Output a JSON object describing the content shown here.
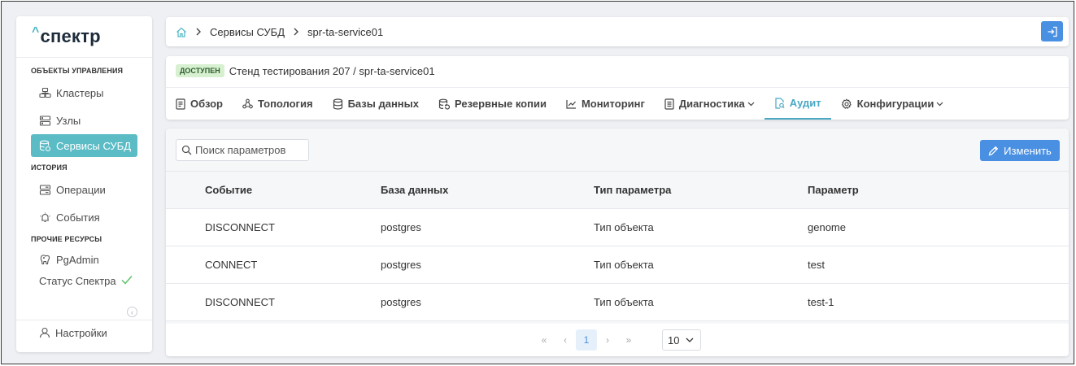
{
  "app": {
    "logo": "спектр"
  },
  "sidebar": {
    "sections": [
      {
        "title": "ОБЪЕКТЫ УПРАВЛЕНИЯ"
      },
      {
        "title": "ИСТОРИЯ"
      },
      {
        "title": "ПРОЧИЕ РЕСУРСЫ"
      }
    ],
    "items": [
      {
        "label": "Кластеры",
        "icon": "cluster-icon"
      },
      {
        "label": "Узлы",
        "icon": "server-icon"
      },
      {
        "label": "Сервисы СУБД",
        "icon": "database-service-icon",
        "active": true
      },
      {
        "label": "Операции",
        "icon": "operations-icon"
      },
      {
        "label": "События",
        "icon": "events-icon"
      },
      {
        "label": "PgAdmin",
        "icon": "pgadmin-elephant-icon"
      }
    ],
    "status_label": "Статус Спектра",
    "settings_label": "Настройки"
  },
  "breadcrumb": {
    "items": [
      "Сервисы СУБД",
      "spr-ta-service01"
    ]
  },
  "header": {
    "badge": "ДОСТУПЕН",
    "title": "Стенд тестирования 207 /  spr-ta-service01"
  },
  "tabs": [
    {
      "label": "Обзор"
    },
    {
      "label": "Топология"
    },
    {
      "label": "Базы данных"
    },
    {
      "label": "Резервные копии"
    },
    {
      "label": "Мониторинг"
    },
    {
      "label": "Диагностика"
    },
    {
      "label": "Аудит",
      "active": true
    },
    {
      "label": "Конфигурации"
    }
  ],
  "toolbar": {
    "search_placeholder": "Поиск параметров",
    "edit_label": "Изменить"
  },
  "table": {
    "columns": [
      "Событие",
      "База данных",
      "Тип параметра",
      "Параметр"
    ],
    "rows": [
      [
        "DISCONNECT",
        "postgres",
        "Тип объекта",
        "genome"
      ],
      [
        "CONNECT",
        "postgres",
        "Тип объекта",
        "test"
      ],
      [
        "DISCONNECT",
        "postgres",
        "Тип объекта",
        "test-1"
      ]
    ]
  },
  "pagination": {
    "current_page": "1",
    "page_size": "10"
  },
  "colors": {
    "accent": "#5bbcc6",
    "primary_button": "#4a90e2",
    "active_tab": "#4aa8c4",
    "status_ok": "#5ec26a"
  }
}
